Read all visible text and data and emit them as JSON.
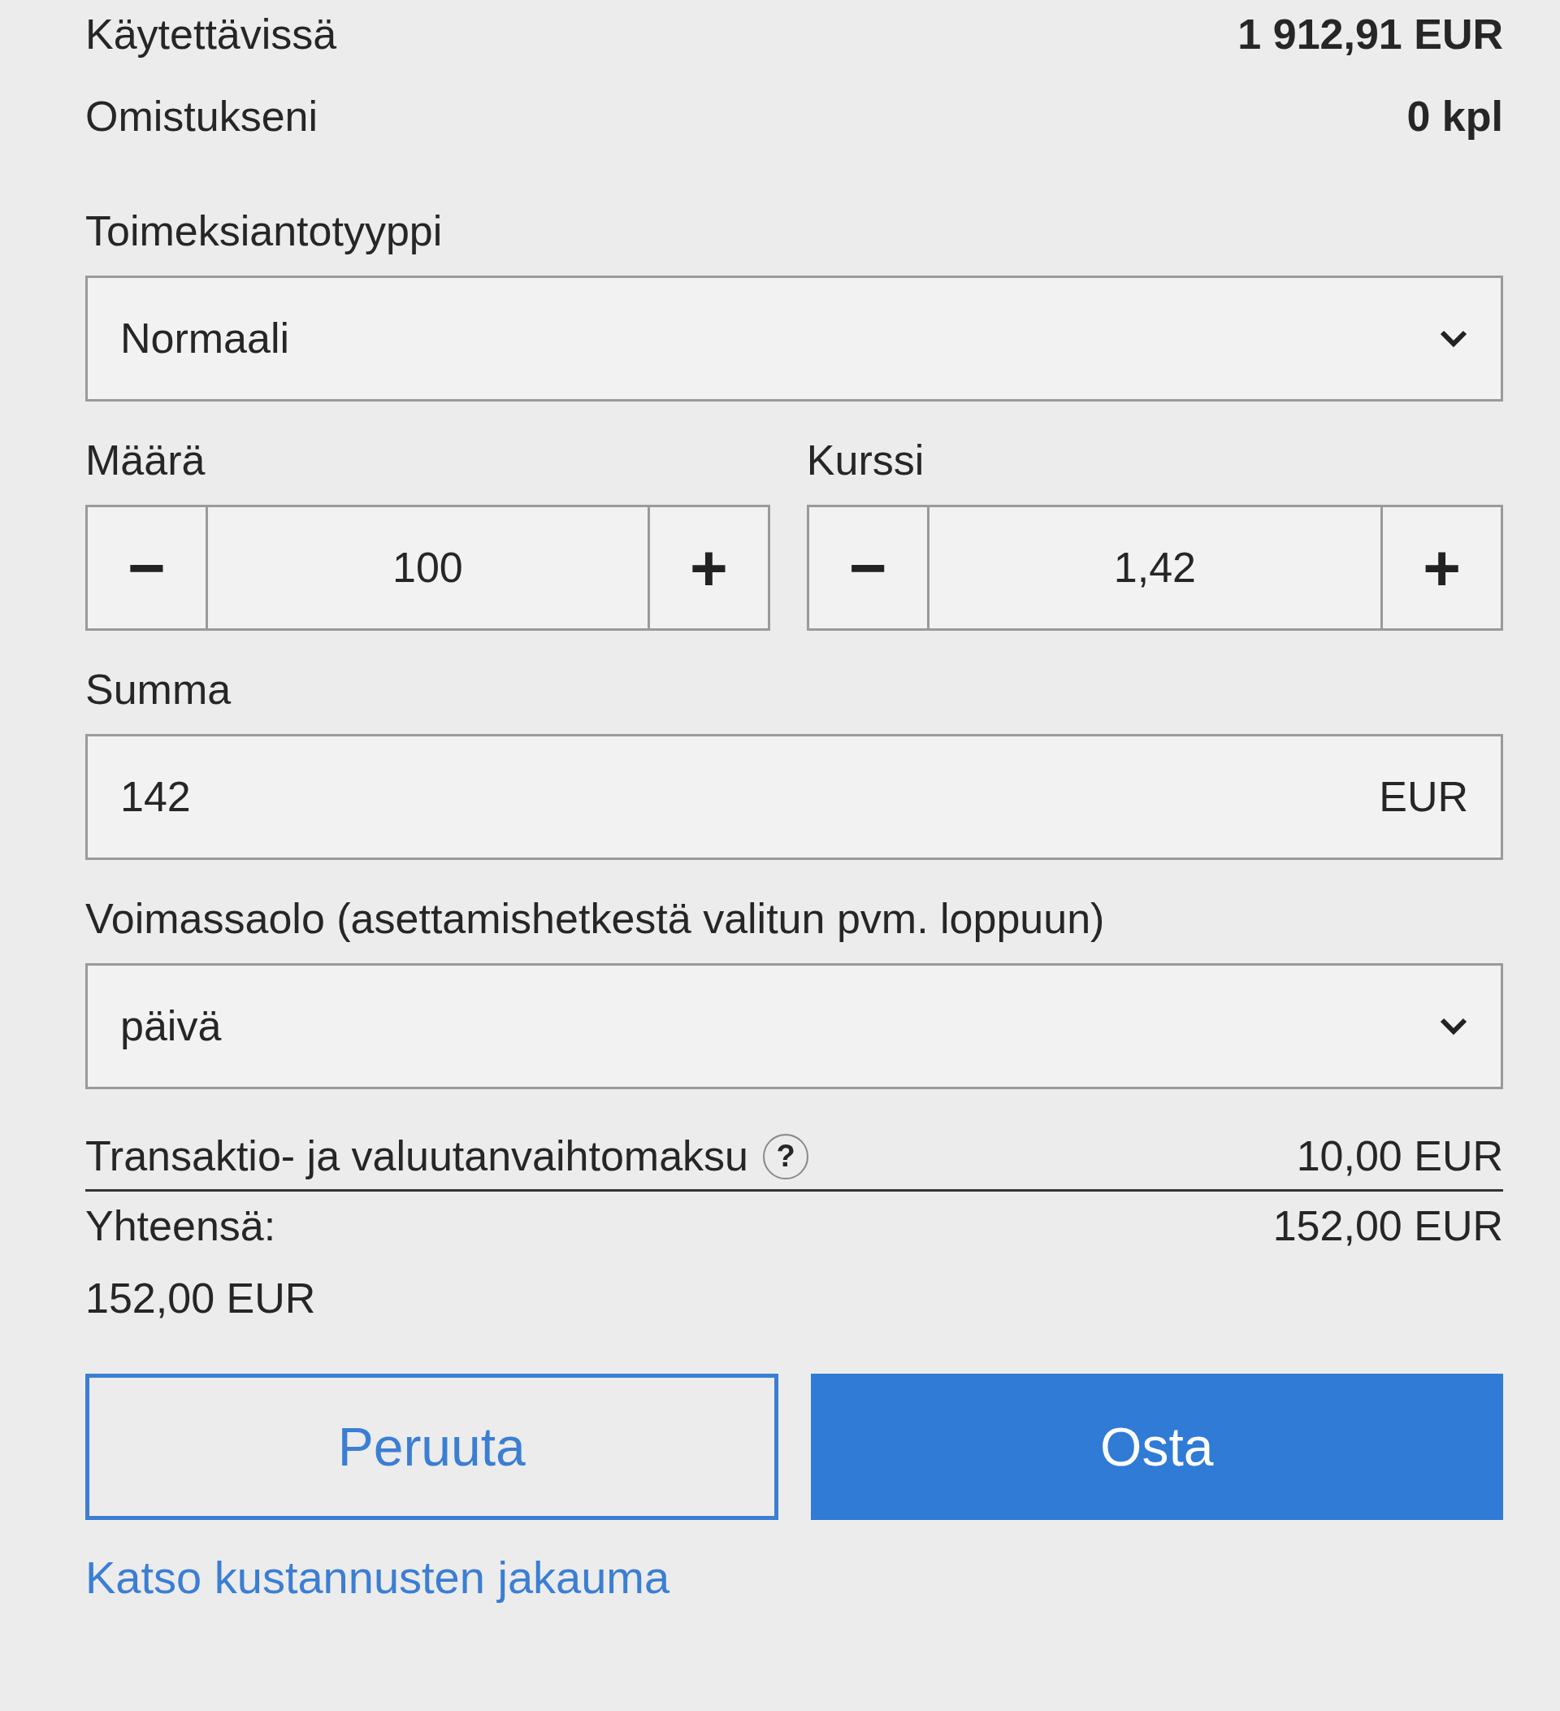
{
  "summary": [
    {
      "label": "Käytettävissä",
      "value": "1 912,91 EUR"
    },
    {
      "label": "Omistukseni",
      "value": "0 kpl"
    }
  ],
  "order_type": {
    "label": "Toimeksiantotyyppi",
    "value": "Normaali"
  },
  "steppers": [
    {
      "label": "Määrä",
      "value": "100",
      "minus": "−",
      "plus": "+"
    },
    {
      "label": "Kurssi",
      "value": "1,42",
      "minus": "−",
      "plus": "+"
    }
  ],
  "sum": {
    "label": "Summa",
    "value": "142",
    "unit": "EUR"
  },
  "validity": {
    "label": "Voimassaolo (asettamishetkestä valitun pvm. loppuun)",
    "value": "päivä"
  },
  "fee": {
    "label": "Transaktio- ja valuutanvaihtomaksu",
    "help": "?",
    "value": "10,00 EUR"
  },
  "total": {
    "label": "Yhteensä:",
    "value": "152,00 EUR",
    "value_below": "152,00 EUR"
  },
  "buttons": [
    {
      "label": "Peruuta",
      "kind": "secondary"
    },
    {
      "label": "Osta",
      "kind": "primary"
    }
  ],
  "link": "Katso kustannusten jakauma"
}
